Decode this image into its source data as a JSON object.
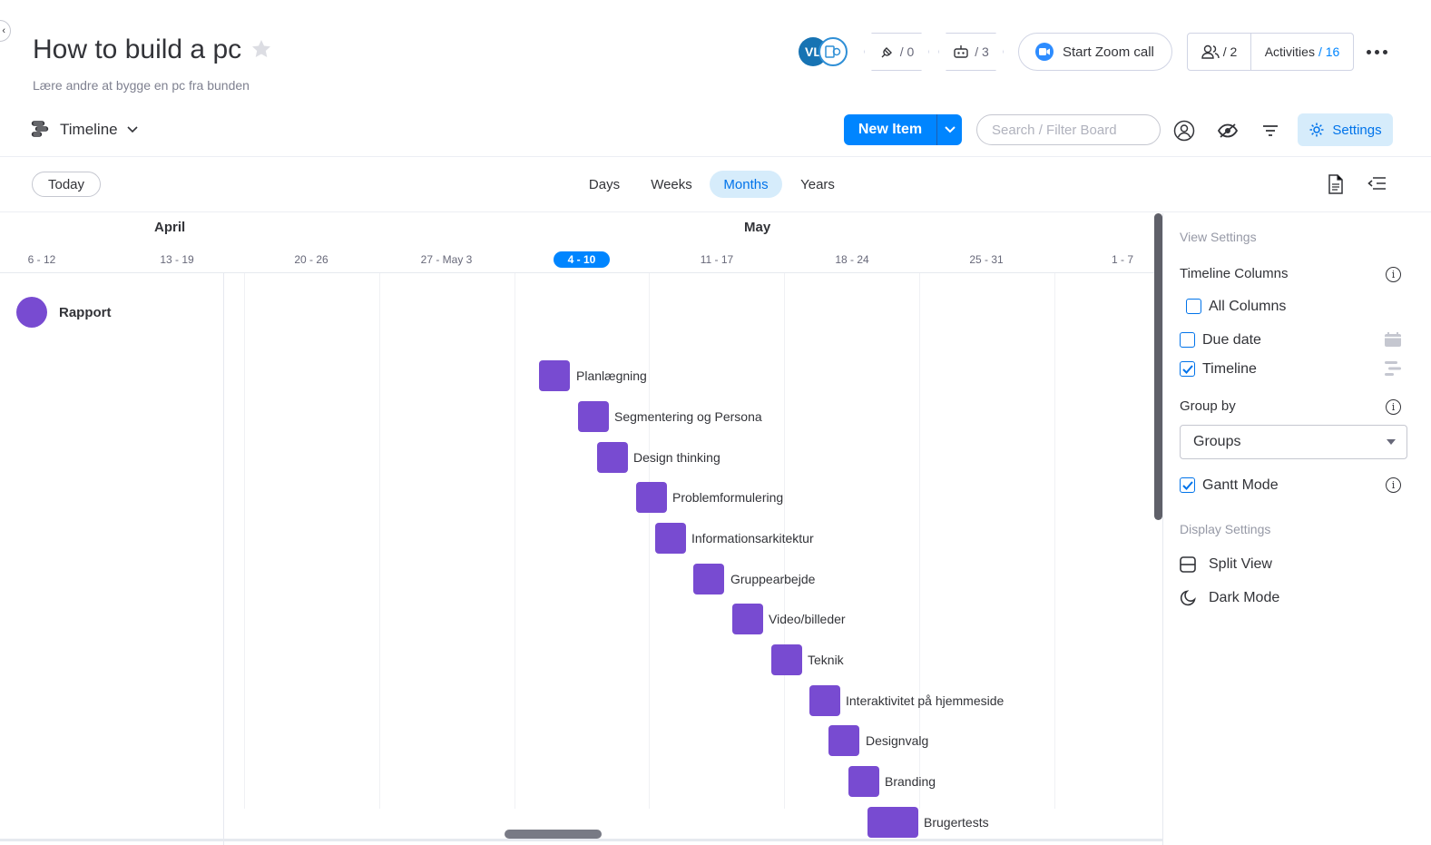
{
  "board": {
    "title": "How to build a pc",
    "description": "Lære andre at bygge en pc fra bunden"
  },
  "header": {
    "avatar_initials": "VL",
    "integrations_count": "/ 0",
    "automations_count": "/ 3",
    "zoom_label": "Start Zoom call",
    "people_count": "/ 2",
    "activities_label": "Activities",
    "activities_count": "/ 16"
  },
  "toolbar": {
    "view_name": "Timeline",
    "new_item_label": "New Item",
    "search_placeholder": "Search / Filter Board",
    "settings_label": "Settings"
  },
  "timeline_controls": {
    "today_label": "Today",
    "scales": [
      "Days",
      "Weeks",
      "Months",
      "Years"
    ],
    "active_scale": "Months"
  },
  "timeline": {
    "months": [
      "April",
      "May"
    ],
    "weeks": [
      "6 - 12",
      "13 - 19",
      "20 - 26",
      "27 - May 3",
      "4 - 10",
      "11 - 17",
      "18 - 24",
      "25 - 31",
      "1 - 7"
    ],
    "current_week": "4 - 10",
    "group": {
      "name": "Rapport",
      "color": "#784bd1"
    },
    "tasks": [
      {
        "name": "Planlægning"
      },
      {
        "name": "Segmentering og Persona"
      },
      {
        "name": "Design thinking"
      },
      {
        "name": "Problemformulering"
      },
      {
        "name": "Informationsarkitektur"
      },
      {
        "name": "Gruppearbejde"
      },
      {
        "name": "Video/billeder"
      },
      {
        "name": "Teknik"
      },
      {
        "name": "Interaktivitet på hjemmeside"
      },
      {
        "name": "Designvalg"
      },
      {
        "name": "Branding"
      },
      {
        "name": "Brugertests"
      }
    ]
  },
  "settings_panel": {
    "view_settings_title": "View Settings",
    "timeline_columns_label": "Timeline Columns",
    "all_columns_label": "All Columns",
    "all_columns_checked": false,
    "due_date_label": "Due date",
    "due_date_checked": false,
    "timeline_label": "Timeline",
    "timeline_checked": true,
    "group_by_label": "Group by",
    "group_by_value": "Groups",
    "gantt_mode_label": "Gantt Mode",
    "gantt_mode_checked": true,
    "display_settings_title": "Display Settings",
    "split_view_label": "Split View",
    "dark_mode_label": "Dark Mode"
  },
  "colors": {
    "accent": "#0085ff",
    "task": "#784bd1",
    "settings_bg": "#d6ecfb"
  }
}
